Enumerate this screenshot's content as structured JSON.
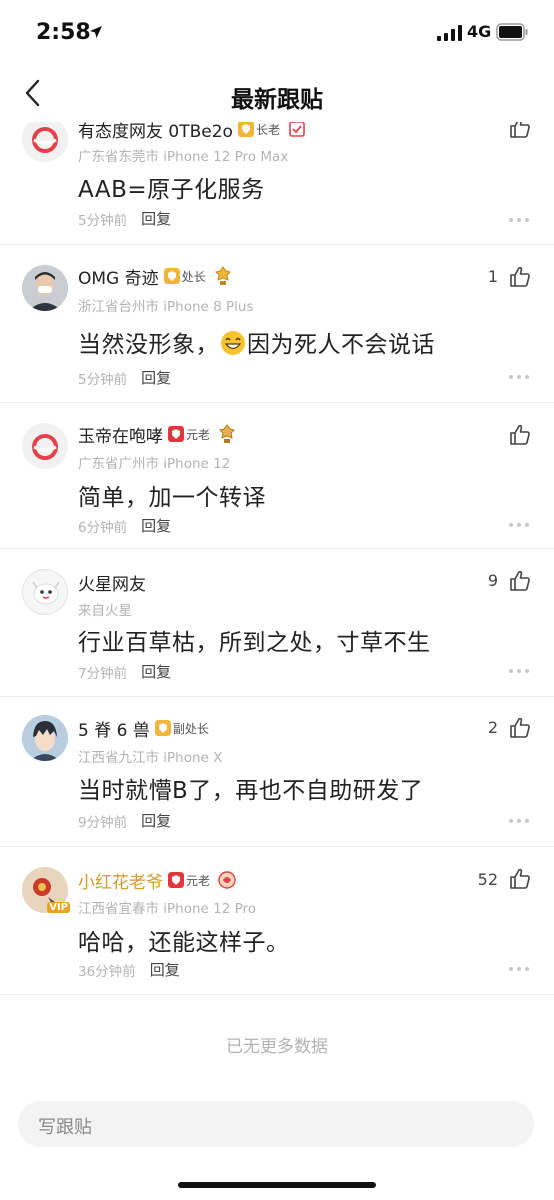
{
  "status_bar": {
    "time": "2:58",
    "network": "4G"
  },
  "nav": {
    "title": "最新跟贴"
  },
  "comments": [
    {
      "username": "有态度网友 0TBe2o",
      "badge": "长老",
      "location": "广东省东莞市  iPhone 12 Pro Max",
      "text": "AAB=原子化服务",
      "time": "5分钟前",
      "reply": "回复",
      "likes": ""
    },
    {
      "username": "OMG 奇迹",
      "badge": "处长",
      "location": "浙江省台州市  iPhone 8 Plus",
      "text_before": "当然没形象，",
      "text_after": "因为死人不会说话",
      "time": "5分钟前",
      "reply": "回复",
      "likes": "1"
    },
    {
      "username": "玉帝在咆哮",
      "badge": "元老",
      "location": "广东省广州市  iPhone 12",
      "text": "简单，加一个转译",
      "time": "6分钟前",
      "reply": "回复",
      "likes": ""
    },
    {
      "username": "火星网友",
      "badge": "",
      "location": "来自火星",
      "text": "行业百草枯，所到之处，寸草不生",
      "time": "7分钟前",
      "reply": "回复",
      "likes": "9"
    },
    {
      "username": "5 脊 6 兽",
      "badge": "副处长",
      "location": "江西省九江市  iPhone X",
      "text": "当时就懵B了，再也不自助研发了",
      "time": "9分钟前",
      "reply": "回复",
      "likes": "2"
    },
    {
      "username": "小红花老爷",
      "badge": "元老",
      "location": "江西省宜春市  iPhone 12 Pro",
      "text": "哈哈，还能这样子。",
      "time": "36分钟前",
      "reply": "回复",
      "likes": "52"
    }
  ],
  "footer": {
    "no_more": "已无更多数据",
    "compose_placeholder": "写跟贴"
  },
  "avatar_label": "VIP",
  "colors": {
    "brand_red": "#e2434a",
    "gold": "#d49a2b",
    "muted": "#b3b3b3",
    "badge_gold": "#f1b53c",
    "badge_red": "#e4343c"
  }
}
